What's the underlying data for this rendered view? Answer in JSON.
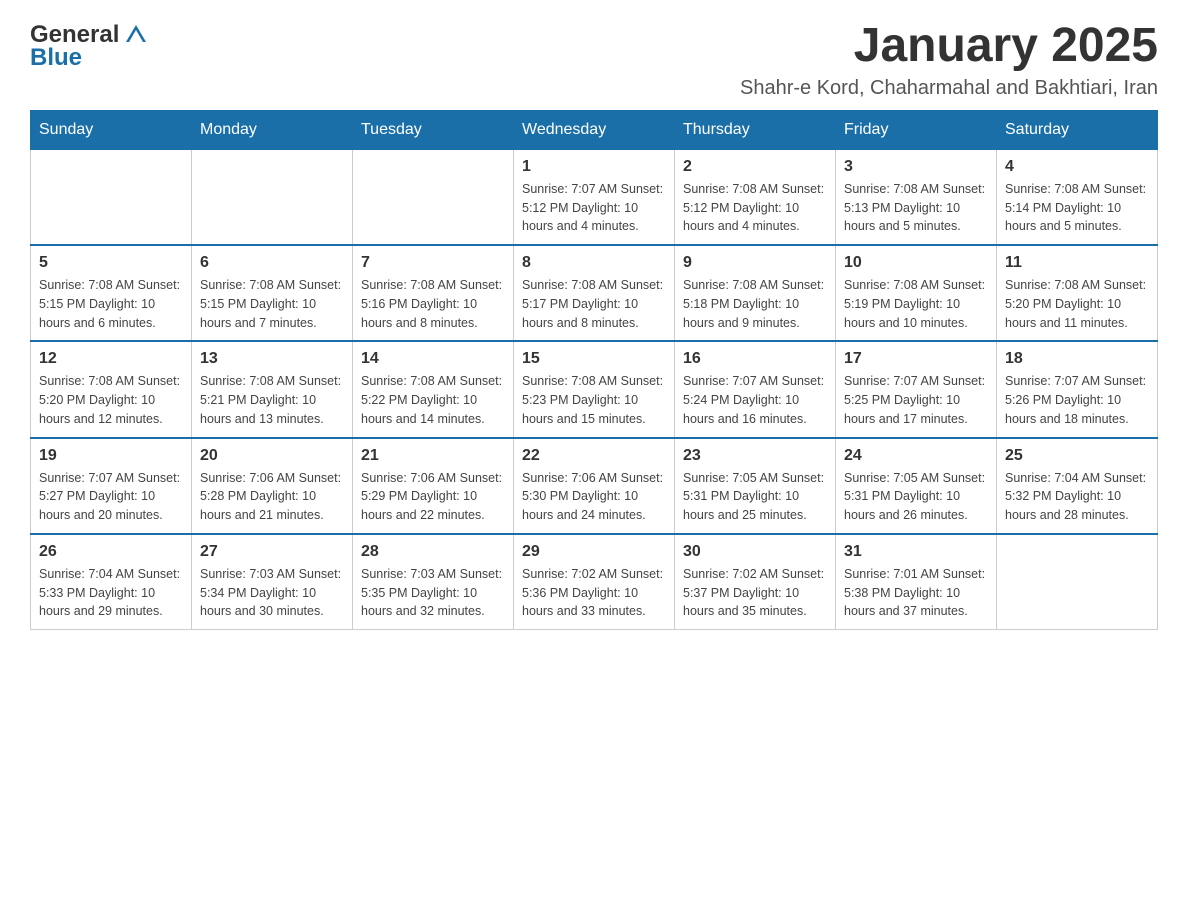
{
  "header": {
    "logo_general": "General",
    "logo_blue": "Blue",
    "month_title": "January 2025",
    "subtitle": "Shahr-e Kord, Chaharmahal and Bakhtiari, Iran"
  },
  "days_of_week": [
    "Sunday",
    "Monday",
    "Tuesday",
    "Wednesday",
    "Thursday",
    "Friday",
    "Saturday"
  ],
  "weeks": [
    {
      "days": [
        {
          "number": "",
          "info": ""
        },
        {
          "number": "",
          "info": ""
        },
        {
          "number": "",
          "info": ""
        },
        {
          "number": "1",
          "info": "Sunrise: 7:07 AM\nSunset: 5:12 PM\nDaylight: 10 hours and 4 minutes."
        },
        {
          "number": "2",
          "info": "Sunrise: 7:08 AM\nSunset: 5:12 PM\nDaylight: 10 hours and 4 minutes."
        },
        {
          "number": "3",
          "info": "Sunrise: 7:08 AM\nSunset: 5:13 PM\nDaylight: 10 hours and 5 minutes."
        },
        {
          "number": "4",
          "info": "Sunrise: 7:08 AM\nSunset: 5:14 PM\nDaylight: 10 hours and 5 minutes."
        }
      ]
    },
    {
      "days": [
        {
          "number": "5",
          "info": "Sunrise: 7:08 AM\nSunset: 5:15 PM\nDaylight: 10 hours and 6 minutes."
        },
        {
          "number": "6",
          "info": "Sunrise: 7:08 AM\nSunset: 5:15 PM\nDaylight: 10 hours and 7 minutes."
        },
        {
          "number": "7",
          "info": "Sunrise: 7:08 AM\nSunset: 5:16 PM\nDaylight: 10 hours and 8 minutes."
        },
        {
          "number": "8",
          "info": "Sunrise: 7:08 AM\nSunset: 5:17 PM\nDaylight: 10 hours and 8 minutes."
        },
        {
          "number": "9",
          "info": "Sunrise: 7:08 AM\nSunset: 5:18 PM\nDaylight: 10 hours and 9 minutes."
        },
        {
          "number": "10",
          "info": "Sunrise: 7:08 AM\nSunset: 5:19 PM\nDaylight: 10 hours and 10 minutes."
        },
        {
          "number": "11",
          "info": "Sunrise: 7:08 AM\nSunset: 5:20 PM\nDaylight: 10 hours and 11 minutes."
        }
      ]
    },
    {
      "days": [
        {
          "number": "12",
          "info": "Sunrise: 7:08 AM\nSunset: 5:20 PM\nDaylight: 10 hours and 12 minutes."
        },
        {
          "number": "13",
          "info": "Sunrise: 7:08 AM\nSunset: 5:21 PM\nDaylight: 10 hours and 13 minutes."
        },
        {
          "number": "14",
          "info": "Sunrise: 7:08 AM\nSunset: 5:22 PM\nDaylight: 10 hours and 14 minutes."
        },
        {
          "number": "15",
          "info": "Sunrise: 7:08 AM\nSunset: 5:23 PM\nDaylight: 10 hours and 15 minutes."
        },
        {
          "number": "16",
          "info": "Sunrise: 7:07 AM\nSunset: 5:24 PM\nDaylight: 10 hours and 16 minutes."
        },
        {
          "number": "17",
          "info": "Sunrise: 7:07 AM\nSunset: 5:25 PM\nDaylight: 10 hours and 17 minutes."
        },
        {
          "number": "18",
          "info": "Sunrise: 7:07 AM\nSunset: 5:26 PM\nDaylight: 10 hours and 18 minutes."
        }
      ]
    },
    {
      "days": [
        {
          "number": "19",
          "info": "Sunrise: 7:07 AM\nSunset: 5:27 PM\nDaylight: 10 hours and 20 minutes."
        },
        {
          "number": "20",
          "info": "Sunrise: 7:06 AM\nSunset: 5:28 PM\nDaylight: 10 hours and 21 minutes."
        },
        {
          "number": "21",
          "info": "Sunrise: 7:06 AM\nSunset: 5:29 PM\nDaylight: 10 hours and 22 minutes."
        },
        {
          "number": "22",
          "info": "Sunrise: 7:06 AM\nSunset: 5:30 PM\nDaylight: 10 hours and 24 minutes."
        },
        {
          "number": "23",
          "info": "Sunrise: 7:05 AM\nSunset: 5:31 PM\nDaylight: 10 hours and 25 minutes."
        },
        {
          "number": "24",
          "info": "Sunrise: 7:05 AM\nSunset: 5:31 PM\nDaylight: 10 hours and 26 minutes."
        },
        {
          "number": "25",
          "info": "Sunrise: 7:04 AM\nSunset: 5:32 PM\nDaylight: 10 hours and 28 minutes."
        }
      ]
    },
    {
      "days": [
        {
          "number": "26",
          "info": "Sunrise: 7:04 AM\nSunset: 5:33 PM\nDaylight: 10 hours and 29 minutes."
        },
        {
          "number": "27",
          "info": "Sunrise: 7:03 AM\nSunset: 5:34 PM\nDaylight: 10 hours and 30 minutes."
        },
        {
          "number": "28",
          "info": "Sunrise: 7:03 AM\nSunset: 5:35 PM\nDaylight: 10 hours and 32 minutes."
        },
        {
          "number": "29",
          "info": "Sunrise: 7:02 AM\nSunset: 5:36 PM\nDaylight: 10 hours and 33 minutes."
        },
        {
          "number": "30",
          "info": "Sunrise: 7:02 AM\nSunset: 5:37 PM\nDaylight: 10 hours and 35 minutes."
        },
        {
          "number": "31",
          "info": "Sunrise: 7:01 AM\nSunset: 5:38 PM\nDaylight: 10 hours and 37 minutes."
        },
        {
          "number": "",
          "info": ""
        }
      ]
    }
  ]
}
